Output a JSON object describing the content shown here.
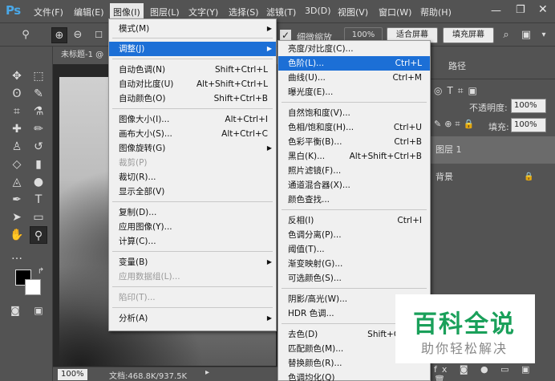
{
  "menubar": {
    "logo": "Ps",
    "items": [
      "文件(F)",
      "编辑(E)",
      "图像(I)",
      "图层(L)",
      "文字(Y)",
      "选择(S)",
      "滤镜(T)",
      "3D(D)",
      "视图(V)",
      "窗口(W)",
      "帮助(H)"
    ],
    "active_index": 2
  },
  "optionsbar": {
    "fine_zoom_label": "细微缩放",
    "zoom_value": "100%",
    "fit_screen": "适合屏幕",
    "fill_screen": "填充屏幕"
  },
  "document": {
    "tab_title": "未标题-1 @",
    "status_zoom": "100%",
    "status_doc": "文档:468.8K/937.5K"
  },
  "right_panel": {
    "paths_tab": "路径",
    "opacity_label": "不透明度:",
    "opacity_value": "100%",
    "fill_label": "填充:",
    "fill_value": "100%",
    "layers": [
      "图层 1",
      "背景"
    ]
  },
  "image_menu": {
    "items": [
      {
        "label": "模式(M)",
        "submenu": true
      },
      {
        "label": "调整(J)",
        "submenu": true,
        "highlight": true
      },
      {
        "label": "自动色调(N)",
        "shortcut": "Shift+Ctrl+L"
      },
      {
        "label": "自动对比度(U)",
        "shortcut": "Alt+Shift+Ctrl+L"
      },
      {
        "label": "自动颜色(O)",
        "shortcut": "Shift+Ctrl+B"
      },
      {
        "label": "图像大小(I)...",
        "shortcut": "Alt+Ctrl+I"
      },
      {
        "label": "画布大小(S)...",
        "shortcut": "Alt+Ctrl+C"
      },
      {
        "label": "图像旋转(G)",
        "submenu": true
      },
      {
        "label": "裁剪(P)",
        "disabled": true
      },
      {
        "label": "裁切(R)..."
      },
      {
        "label": "显示全部(V)"
      },
      {
        "label": "复制(D)..."
      },
      {
        "label": "应用图像(Y)..."
      },
      {
        "label": "计算(C)..."
      },
      {
        "label": "变量(B)",
        "submenu": true
      },
      {
        "label": "应用数据组(L)...",
        "disabled": true
      },
      {
        "label": "陷印(T)...",
        "disabled": true
      },
      {
        "label": "分析(A)",
        "submenu": true
      }
    ]
  },
  "adjust_menu": {
    "items": [
      {
        "label": "亮度/对比度(C)..."
      },
      {
        "label": "色阶(L)...",
        "shortcut": "Ctrl+L",
        "highlight": true
      },
      {
        "label": "曲线(U)...",
        "shortcut": "Ctrl+M"
      },
      {
        "label": "曝光度(E)..."
      },
      {
        "label": "自然饱和度(V)..."
      },
      {
        "label": "色相/饱和度(H)...",
        "shortcut": "Ctrl+U"
      },
      {
        "label": "色彩平衡(B)...",
        "shortcut": "Ctrl+B"
      },
      {
        "label": "黑白(K)...",
        "shortcut": "Alt+Shift+Ctrl+B"
      },
      {
        "label": "照片滤镜(F)..."
      },
      {
        "label": "通道混合器(X)..."
      },
      {
        "label": "颜色查找..."
      },
      {
        "label": "反相(I)",
        "shortcut": "Ctrl+I"
      },
      {
        "label": "色调分离(P)..."
      },
      {
        "label": "阈值(T)..."
      },
      {
        "label": "渐变映射(G)..."
      },
      {
        "label": "可选颜色(S)..."
      },
      {
        "label": "阴影/高光(W)..."
      },
      {
        "label": "HDR 色调..."
      },
      {
        "label": "去色(D)",
        "shortcut": "Shift+Ctrl+U"
      },
      {
        "label": "匹配颜色(M)..."
      },
      {
        "label": "替换颜色(R)..."
      },
      {
        "label": "色调均化(Q)"
      }
    ]
  },
  "watermark": {
    "title": "百科全说",
    "subtitle": "助你轻松解决"
  }
}
